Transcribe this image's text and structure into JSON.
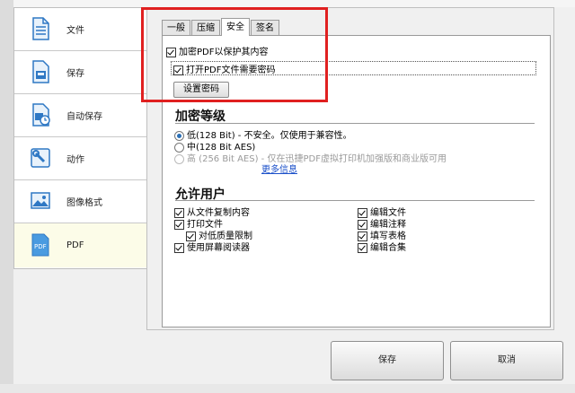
{
  "sidebar": {
    "items": [
      {
        "label": "文件",
        "icon": "document-icon"
      },
      {
        "label": "保存",
        "icon": "save-document-icon"
      },
      {
        "label": "自动保存",
        "icon": "auto-save-icon"
      },
      {
        "label": "动作",
        "icon": "wrench-icon"
      },
      {
        "label": "图像格式",
        "icon": "image-icon"
      },
      {
        "label": "PDF",
        "icon": "pdf-icon",
        "active": true
      }
    ]
  },
  "tabs": [
    "一般",
    "压缩",
    "安全",
    "签名"
  ],
  "active_tab": "安全",
  "security": {
    "encrypt_label": "加密PDF以保护其内容",
    "open_password_label": "打开PDF文件需要密码",
    "set_password_button": "设置密码"
  },
  "encryption": {
    "title": "加密等级",
    "options": [
      {
        "label": "低(128 Bit) - 不安全。仅使用于兼容性。",
        "selected": true,
        "enabled": true
      },
      {
        "label": "中(128 Bit AES)",
        "selected": false,
        "enabled": true
      },
      {
        "label": "高 (256 Bit AES) - 仅在迅捷PDF虚拟打印机加强版和商业版可用",
        "selected": false,
        "enabled": false
      }
    ],
    "more_info": "更多信息"
  },
  "permissions": {
    "title": "允许用户",
    "left": [
      {
        "label": "从文件复制内容",
        "checked": true
      },
      {
        "label": "打印文件",
        "checked": true
      },
      {
        "label": "对低质量限制",
        "checked": true
      },
      {
        "label": "使用屏幕阅读器",
        "checked": true
      }
    ],
    "right": [
      {
        "label": "编辑文件",
        "checked": true
      },
      {
        "label": "编辑注释",
        "checked": true
      },
      {
        "label": "填写表格",
        "checked": true
      },
      {
        "label": "编辑合集",
        "checked": true
      }
    ]
  },
  "footer": {
    "save_label": "保存",
    "cancel_label": "取消"
  },
  "colors": {
    "accent": "#2a6fb5",
    "highlight_box": "#e02020",
    "link": "#1a4fc9"
  }
}
